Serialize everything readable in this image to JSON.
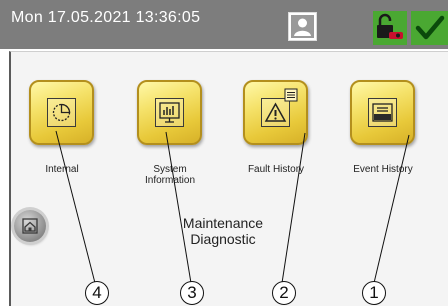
{
  "status_bar": {
    "datetime": "Mon 17.05.2021  13:36:05",
    "icons": [
      "user-icon",
      "lock-key-icon",
      "checkmark-icon"
    ]
  },
  "tiles": [
    {
      "label": "Internal",
      "icon": "pie-chart-icon"
    },
    {
      "label": "System Information",
      "icon": "bar-chart-icon"
    },
    {
      "label": "Fault History",
      "icon": "warning-icon"
    },
    {
      "label": "Event History",
      "icon": "folder-icon"
    }
  ],
  "home_button": {
    "icon": "home-icon"
  },
  "section_title": "Maintenance Diagnostic",
  "callouts": [
    "4",
    "3",
    "2",
    "1"
  ],
  "colors": {
    "header": "#7d7d7d",
    "tile": "#f0d85a",
    "status_ok": "#4aa832"
  }
}
